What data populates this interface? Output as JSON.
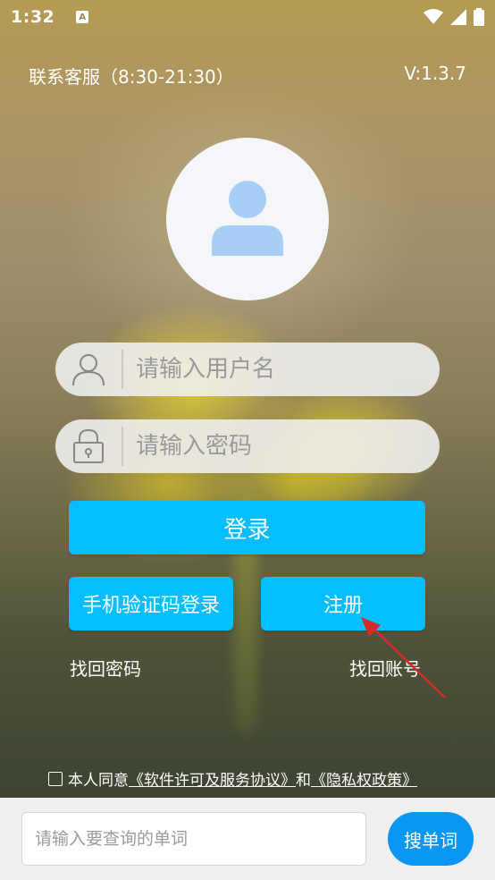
{
  "status_bar": {
    "time": "1:32",
    "notification_glyph": "A"
  },
  "header": {
    "customer_service": "联系客服（8:30-21:30）",
    "version": "V:1.3.7"
  },
  "login": {
    "username_placeholder": "请输入用户名",
    "password_placeholder": "请输入密码",
    "login_label": "登录",
    "sms_login_label": "手机验证码登录",
    "register_label": "注册",
    "forgot_password": "找回密码",
    "recover_account": "找回账号"
  },
  "agreement": {
    "prefix": "本人同意",
    "software_agreement": "《软件许可及服务协议》",
    "and": "和",
    "privacy_policy": "《隐私权政策》"
  },
  "search": {
    "placeholder": "请输入要查询的单词",
    "button_label": "搜单词"
  },
  "colors": {
    "primary_button": "#04befe",
    "search_button": "#0a97f3",
    "arrow": "#d62a2a"
  }
}
